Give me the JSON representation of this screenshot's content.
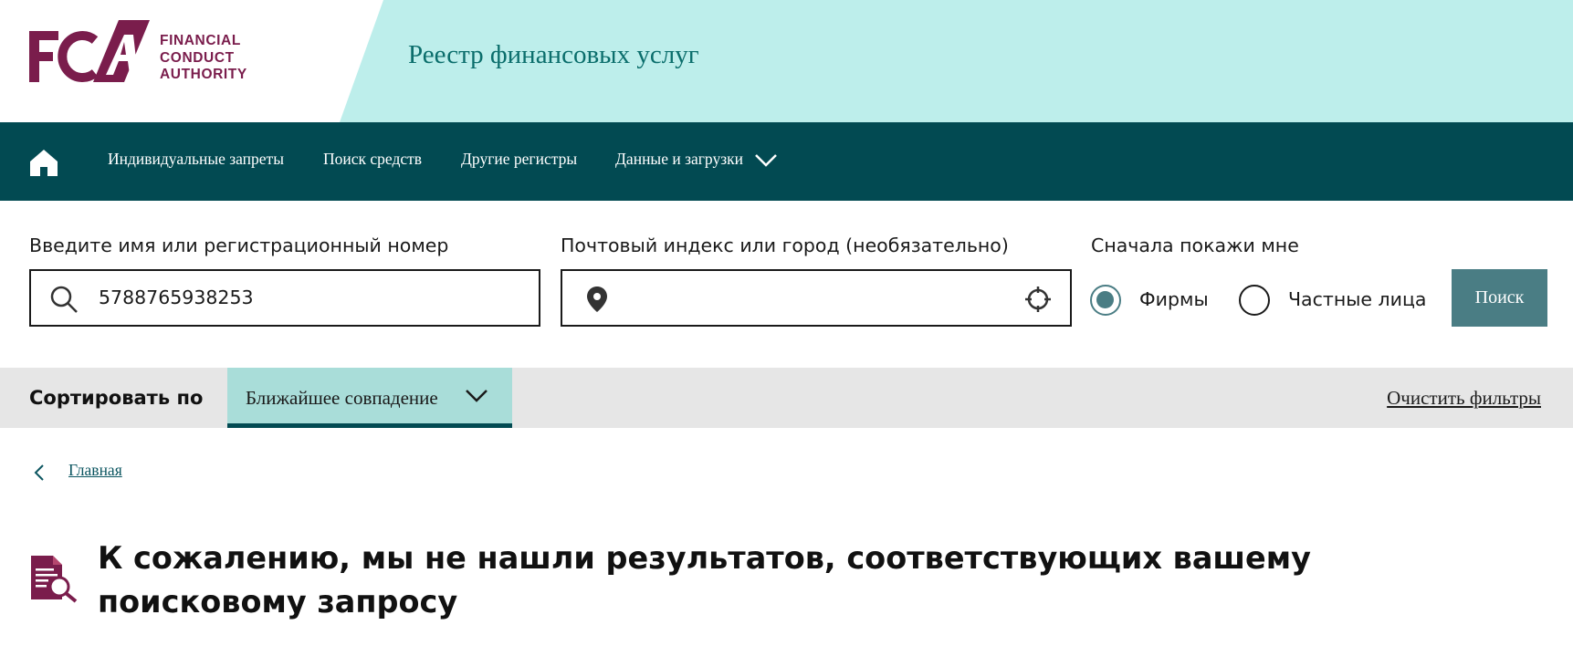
{
  "header": {
    "logo_mark": "FCA",
    "logo_lines": [
      "FINANCIAL",
      "CONDUCT",
      "AUTHORITY"
    ],
    "site_title": "Реестр финансовых услуг"
  },
  "nav": {
    "home_icon": "home-icon",
    "items": [
      {
        "label": "Индивидуальные запреты"
      },
      {
        "label": "Поиск средств"
      },
      {
        "label": "Другие регистры"
      },
      {
        "label": "Данные и загрузки"
      }
    ]
  },
  "search": {
    "name_label": "Введите имя или регистрационный номер",
    "name_value": "5788765938253",
    "postcode_label": "Почтовый индекс или город (необязательно)",
    "postcode_value": "",
    "show_label": "Сначала покажи мне",
    "options": [
      {
        "label": "Фирмы",
        "checked": true
      },
      {
        "label": "Частные лица",
        "checked": false
      }
    ],
    "button_label": "Поиск"
  },
  "sort": {
    "label": "Сортировать по",
    "selected": "Ближайшее совпадение",
    "clear_label": "Очистить фильтры"
  },
  "breadcrumb": {
    "back_label": "Главная"
  },
  "results": {
    "message": "К сожалению, мы не нашли результатов, соответствующих вашему поисковому запросу"
  },
  "colors": {
    "brand": "#7a1d4c",
    "nav_bg": "#024a52",
    "header_band": "#bdeeeb",
    "accent": "#4a7d84",
    "sort_select_bg": "#a9ddd9"
  }
}
